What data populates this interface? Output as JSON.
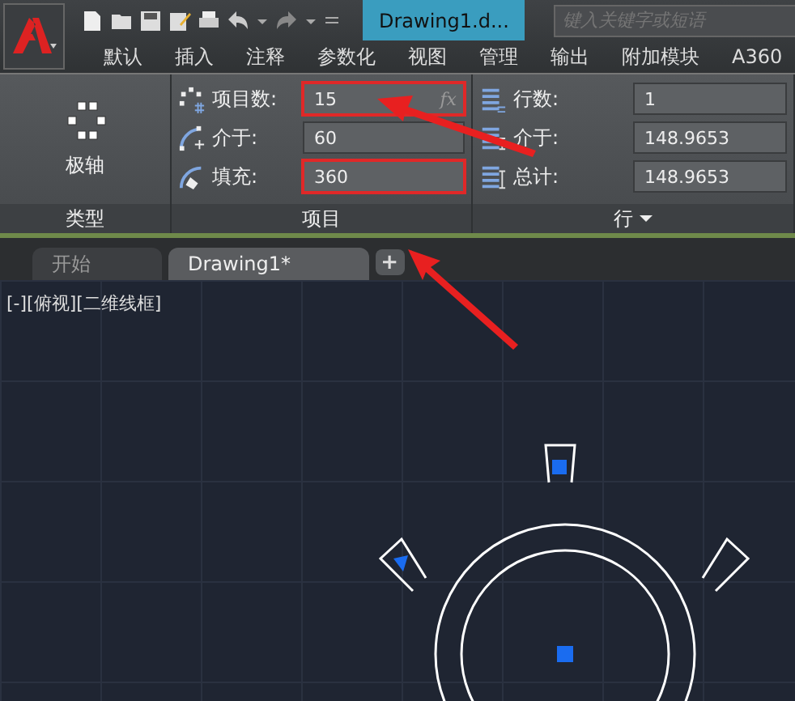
{
  "title_bar": {
    "document_tab": "Drawing1.d...",
    "search": {
      "placeholder": "键入关键字或短语"
    }
  },
  "menu": [
    "默认",
    "插入",
    "注释",
    "参数化",
    "视图",
    "管理",
    "输出",
    "附加模块",
    "A360"
  ],
  "ribbon": {
    "type_panel": {
      "title": "类型",
      "button": "极轴"
    },
    "items_panel": {
      "title": "项目",
      "fields": [
        {
          "kind": "count",
          "label": "项目数:",
          "value": "15",
          "highlighted": true,
          "suffix": "fx"
        },
        {
          "kind": "between",
          "label": "介于:",
          "value": "60",
          "highlighted": false
        },
        {
          "kind": "fill",
          "label": "填充:",
          "value": "360",
          "highlighted": true
        }
      ]
    },
    "rows_panel": {
      "title": "行",
      "fields": [
        {
          "kind": "count",
          "label": "行数:",
          "value": "1"
        },
        {
          "kind": "between",
          "label": "介于:",
          "value": "148.9653"
        },
        {
          "kind": "total",
          "label": "总计:",
          "value": "148.9653"
        }
      ]
    }
  },
  "tabs": [
    {
      "label": "开始",
      "selected": false
    },
    {
      "label": "Drawing1*",
      "selected": true
    }
  ],
  "new_tab": "+",
  "viewport": {
    "label": "[-][俯视][二维线框]"
  }
}
